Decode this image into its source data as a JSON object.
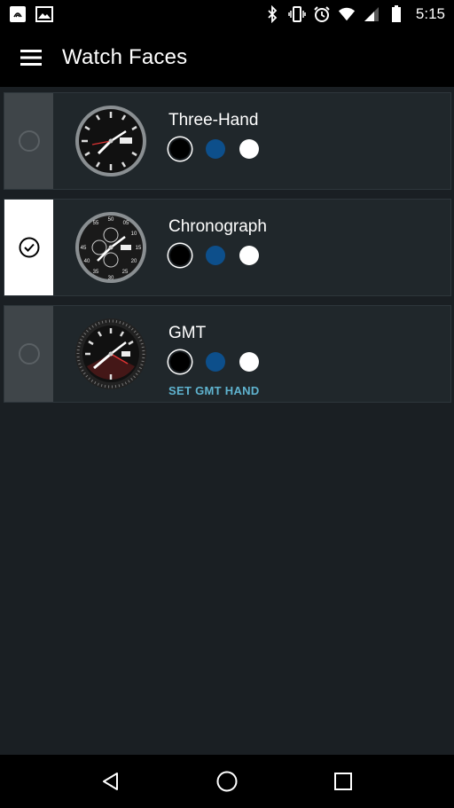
{
  "status_bar": {
    "time": "5:15",
    "icons_left": [
      "nfc-icon",
      "image-icon"
    ],
    "icons_right": [
      "bluetooth-icon",
      "vibrate-icon",
      "alarm-icon",
      "wifi-icon",
      "signal-icon",
      "battery-icon"
    ]
  },
  "app_bar": {
    "title": "Watch Faces",
    "menu_icon": "hamburger-menu-icon"
  },
  "faces": [
    {
      "name": "Three-Hand",
      "selected": false,
      "colors": [
        "#000000",
        "#0d4f8b",
        "#ffffff"
      ],
      "selected_color": "black"
    },
    {
      "name": "Chronograph",
      "selected": true,
      "colors": [
        "#000000",
        "#0d4f8b",
        "#ffffff"
      ],
      "selected_color": "black"
    },
    {
      "name": "GMT",
      "selected": false,
      "colors": [
        "#000000",
        "#0d4f8b",
        "#ffffff"
      ],
      "selected_color": "black",
      "action": "SET GMT HAND"
    }
  ],
  "chrono_labels": [
    "50",
    "55",
    "05",
    "10",
    "15",
    "20",
    "25",
    "30",
    "35",
    "40",
    "45"
  ],
  "nav_bar": {
    "back_icon": "back-icon",
    "home_icon": "home-icon",
    "recents_icon": "recents-icon"
  },
  "theme": {
    "background": "#1a1f23",
    "card": "#20272b",
    "accent": "#5fb3cf"
  }
}
